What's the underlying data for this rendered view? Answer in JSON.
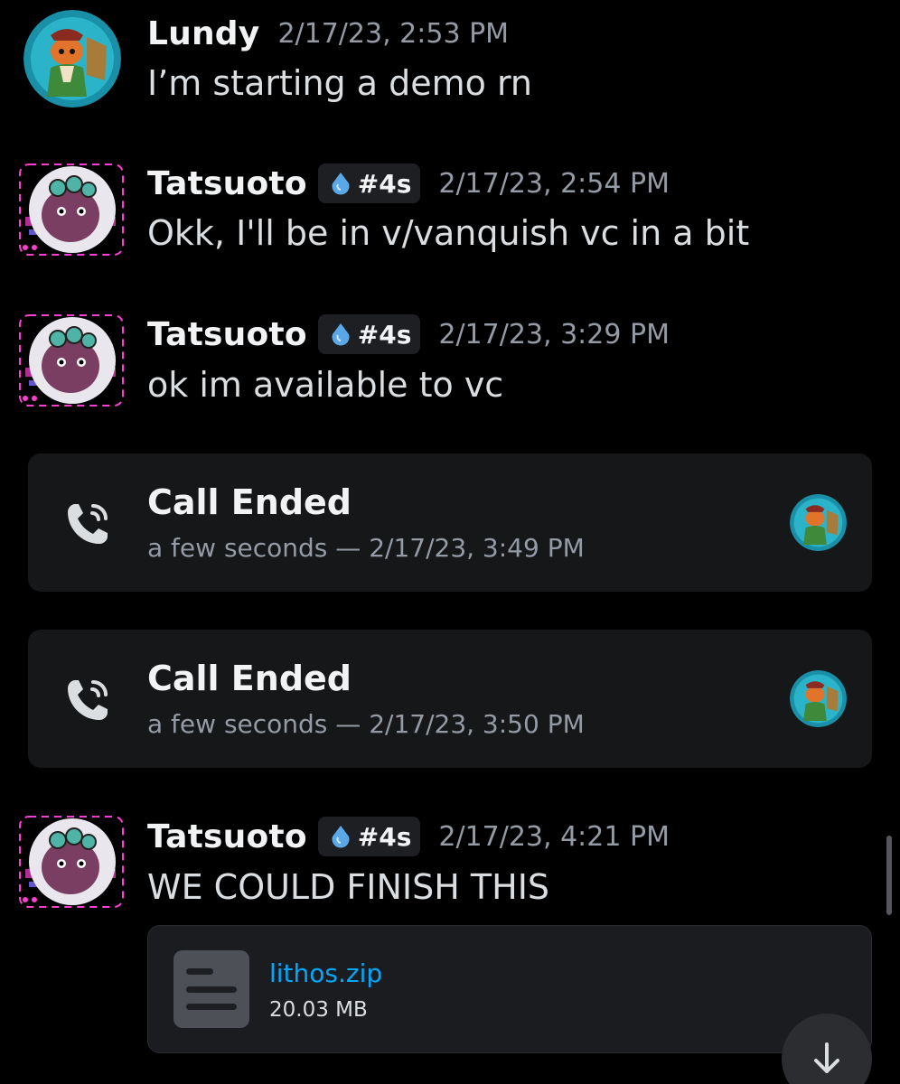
{
  "messages": [
    {
      "author": "Lundy",
      "timestamp": "2/17/23, 2:53 PM",
      "text": "I’m starting a demo rn"
    },
    {
      "author": "Tatsuoto",
      "tag": "#4s",
      "timestamp": "2/17/23, 2:54 PM",
      "text": "Okk, I'll be in v/vanquish vc in a bit"
    },
    {
      "author": "Tatsuoto",
      "tag": "#4s",
      "timestamp": "2/17/23, 3:29 PM",
      "text": "ok im available to vc"
    },
    {
      "author": "Tatsuoto",
      "tag": "#4s",
      "timestamp": "2/17/23, 4:21 PM",
      "text": "WE COULD FINISH THIS"
    }
  ],
  "calls": [
    {
      "title": "Call Ended",
      "detail": "a few seconds — 2/17/23, 3:49 PM"
    },
    {
      "title": "Call Ended",
      "detail": "a few seconds — 2/17/23, 3:50 PM"
    }
  ],
  "attachment": {
    "name": "lithos.zip",
    "size": "20.03 MB"
  },
  "colors": {
    "background": "#000000",
    "card": "#161719",
    "link": "#00a8fc",
    "muted": "#949ba4"
  },
  "icons": {
    "tag": "water-drop-icon",
    "call": "phone-call-icon",
    "file": "file-icon",
    "jump": "arrow-down-icon"
  }
}
